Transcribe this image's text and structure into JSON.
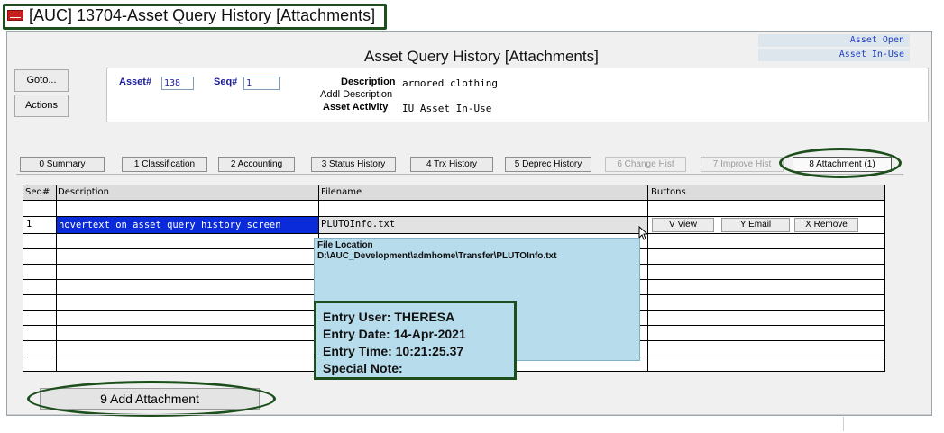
{
  "window": {
    "title": "[AUC] 13704-Asset Query History [Attachments]",
    "screen_title": "Asset Query History [Attachments]",
    "status": [
      "Asset Open",
      "Asset In-Use"
    ]
  },
  "side_buttons": [
    "Goto...",
    "Actions"
  ],
  "header": {
    "asset_label": "Asset#",
    "asset_value": "138",
    "seq_label": "Seq#",
    "seq_value": "1",
    "description_label": "Description",
    "description_value": "armored clothing",
    "addl_description_label": "Addl Description",
    "asset_activity_label": "Asset Activity",
    "asset_activity_value": "IU Asset In-Use"
  },
  "tabs": [
    {
      "label": "0 Summary",
      "state": "normal"
    },
    {
      "label": "1 Classification",
      "state": "normal"
    },
    {
      "label": "2 Accounting",
      "state": "normal"
    },
    {
      "label": "3 Status History",
      "state": "normal"
    },
    {
      "label": "4 Trx History",
      "state": "normal"
    },
    {
      "label": "5 Deprec History",
      "state": "normal"
    },
    {
      "label": "6 Change Hist",
      "state": "disabled"
    },
    {
      "label": "7 Improve Hist",
      "state": "disabled"
    },
    {
      "label": "8 Attachment (1)",
      "state": "active"
    }
  ],
  "grid": {
    "columns": [
      "Seq#",
      "Description",
      "Filename",
      "Buttons"
    ],
    "rows": [
      {
        "seq": "1",
        "description": "hovertext on asset query history screen",
        "filename": "PLUTOInfo.txt",
        "buttons": [
          "V View",
          "Y Email",
          "X Remove"
        ]
      }
    ]
  },
  "tooltip": {
    "title": "File Location",
    "path": "D:\\AUC_Development\\admhome\\Transfer\\PLUTOInfo.txt",
    "entry_user": "Entry User: THERESA",
    "entry_date": "Entry Date: 14-Apr-2021",
    "entry_time": "Entry Time: 10:21:25.37",
    "special_note": "Special Note:"
  },
  "add_attachment_label": "9 Add Attachment",
  "colors": {
    "highlight_green": "#1d4f1d",
    "selection_blue": "#0a2bd9",
    "tooltip_bg": "#b7dcec",
    "status_text": "#1f3dbf"
  },
  "icons": [
    "app-icon",
    "mouse-cursor-icon"
  ]
}
